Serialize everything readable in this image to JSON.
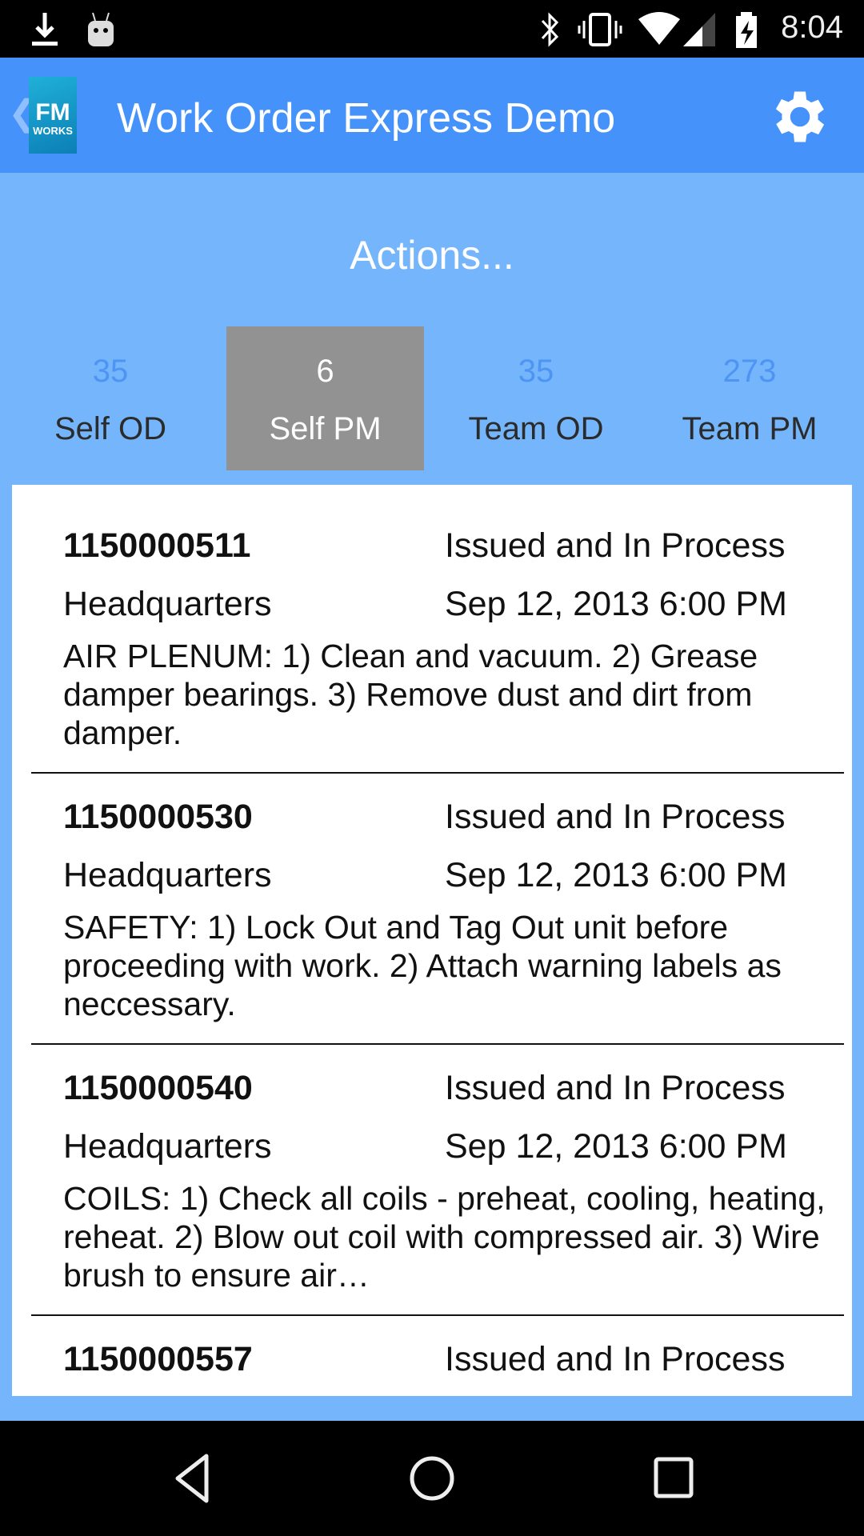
{
  "status_bar": {
    "time": "8:04",
    "icons": [
      "download-icon",
      "android-icon",
      "bluetooth-icon",
      "vibrate-icon",
      "wifi-icon",
      "signal-icon",
      "battery-charging-icon"
    ]
  },
  "app_bar": {
    "title": "Work Order Express Demo",
    "logo": {
      "line1": "FM",
      "line2": "WORKS"
    },
    "settings_icon": "gear-icon",
    "color": "#4592fb"
  },
  "actions_label": "Actions...",
  "tabs": [
    {
      "count": "35",
      "label": "Self OD",
      "selected": false
    },
    {
      "count": "6",
      "label": "Self PM",
      "selected": true
    },
    {
      "count": "35",
      "label": "Team OD",
      "selected": false
    },
    {
      "count": "273",
      "label": "Team PM",
      "selected": false
    }
  ],
  "work_orders": [
    {
      "id": "1150000511",
      "status": "Issued and In Process",
      "location": "Headquarters",
      "date": "Sep 12, 2013 6:00 PM",
      "description": "AIR PLENUM: 1) Clean and vacuum. 2) Grease damper bearings. 3) Remove dust and dirt from damper."
    },
    {
      "id": "1150000530",
      "status": "Issued and In Process",
      "location": "Headquarters",
      "date": "Sep 12, 2013 6:00 PM",
      "description": "SAFETY: 1) Lock Out and Tag Out unit before proceeding with work. 2) Attach warning labels as neccessary."
    },
    {
      "id": "1150000540",
      "status": "Issued and In Process",
      "location": "Headquarters",
      "date": "Sep 12, 2013 6:00 PM",
      "description": "COILS: 1) Check all coils - preheat, cooling, heating, reheat. 2) Blow out coil with compressed air. 3) Wire brush to ensure air…"
    },
    {
      "id": "1150000557",
      "status": "Issued and In Process",
      "location": "",
      "date": "",
      "description": ""
    }
  ],
  "colors": {
    "background": "#74b5fb",
    "selected_tab": "#929292",
    "count": "#4d94f5"
  }
}
